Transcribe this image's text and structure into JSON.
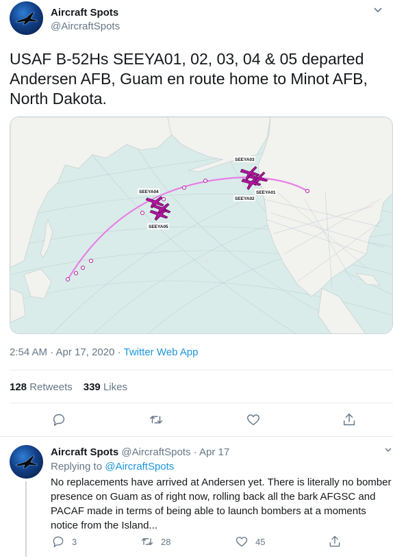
{
  "tweet": {
    "author_name": "Aircraft Spots",
    "author_handle": "@AircraftSpots",
    "text": "USAF B-52Hs SEEYA01, 02, 03, 04 & 05 departed Andersen AFB, Guam en route home to Minot AFB, North Dakota.",
    "time": "2:54 AM · Apr 17, 2020 · ",
    "source": "Twitter Web App",
    "retweets_count": "128",
    "retweets_label": "Retweets",
    "likes_count": "339",
    "likes_label": "Likes",
    "icons": [
      "reply-icon",
      "retweet-icon",
      "like-icon",
      "share-icon",
      "caret-down-icon",
      "avatar-plane-icon"
    ]
  },
  "map": {
    "aircraft_labels": [
      "SEEYA01",
      "SEEYA02",
      "SEEYA03",
      "SEEYA04",
      "SEEYA05"
    ],
    "colors": {
      "water": "#d9ece9",
      "land": "#f2f2ee",
      "track": "#e87de8",
      "aircraft": "#b3139f"
    }
  },
  "reply": {
    "author_name": "Aircraft Spots",
    "author_handle": "@AircraftSpots",
    "date": "Apr 17",
    "replying_prefix": "Replying to ",
    "replying_to": "@AircraftSpots",
    "text": "No replacements have arrived at Andersen yet. There is literally no bomber presence on Guam as of right now, rolling back all the bark AFGSC and PACAF made in terms of being able to launch bombers at a moments notice from the Island...",
    "replies": "3",
    "retweets": "28",
    "likes": "45"
  },
  "colors": {
    "link": "#1b95e0",
    "muted": "#657786",
    "text": "#14171a",
    "border": "#e6ecf0"
  }
}
